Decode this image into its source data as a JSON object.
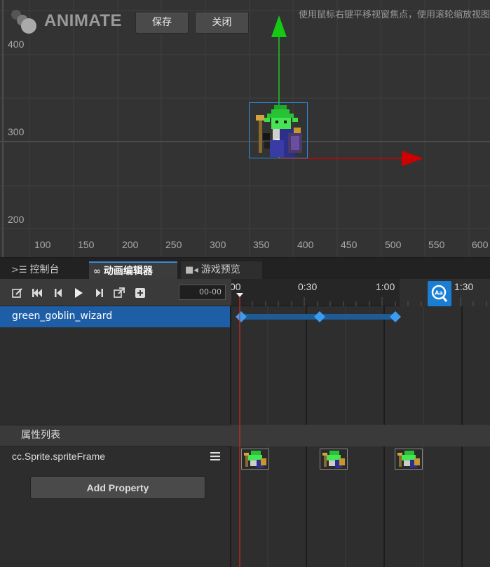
{
  "scene": {
    "logo_text": "ANIMATE",
    "buttons": {
      "save": "保存",
      "close": "关闭"
    },
    "hint": "使用鼠标右键平移视窗焦点，使用滚轮缩放视图",
    "y_axis_labels": [
      "400",
      "300",
      "200"
    ],
    "x_axis_labels": [
      "100",
      "150",
      "200",
      "250",
      "300",
      "350",
      "400",
      "450",
      "500",
      "550",
      "600"
    ]
  },
  "tabs": [
    {
      "label": "控制台",
      "icon": "console-icon"
    },
    {
      "label": "动画编辑器",
      "icon": "animation-icon"
    },
    {
      "label": "游戏预览",
      "icon": "camera-icon"
    }
  ],
  "toolbar": {
    "icons": [
      "edit-icon",
      "first-frame-icon",
      "prev-frame-icon",
      "play-icon",
      "next-frame-icon",
      "export-icon",
      "add-icon"
    ],
    "time_value": "00-00"
  },
  "timeline": {
    "ruler_labels": [
      "00",
      "0:30",
      "1:00",
      "1:30"
    ],
    "node_name": "green_goblin_wizard"
  },
  "properties": {
    "header": "属性列表",
    "property_name": "cc.Sprite.spriteFrame",
    "add_button": "Add Property"
  },
  "colors": {
    "selection_blue": "#1e5ea7",
    "accent_blue": "#1a7fd4",
    "keyframe_blue": "#3b9cf0",
    "playhead_red": "#d62828",
    "gizmo_green": "#1ec81e",
    "gizmo_red": "#d00000"
  }
}
